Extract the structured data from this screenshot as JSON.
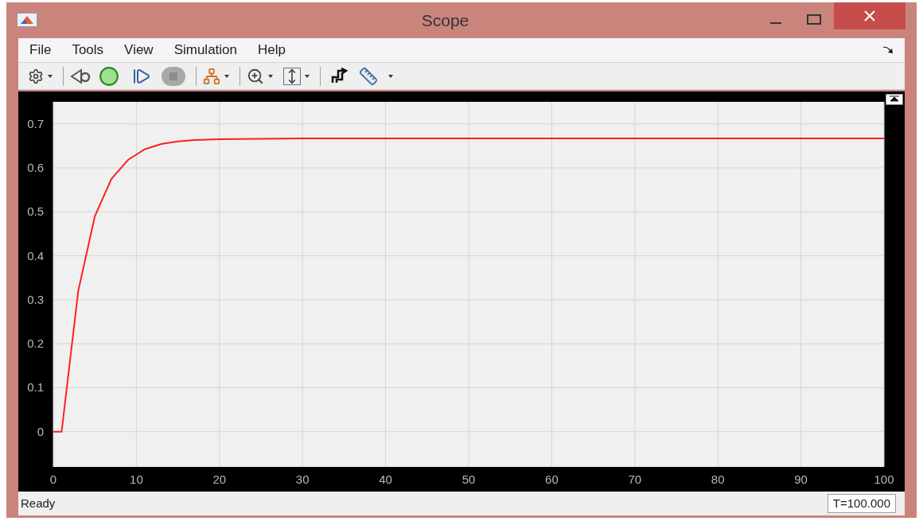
{
  "window": {
    "title": "Scope"
  },
  "menu": [
    "File",
    "Tools",
    "View",
    "Simulation",
    "Help"
  ],
  "plot": {
    "chart_data": {
      "type": "line",
      "grid": true,
      "xlim": [
        0,
        100
      ],
      "ylim": [
        -0.08,
        0.75
      ],
      "xticks": [
        0,
        10,
        20,
        30,
        40,
        50,
        60,
        70,
        80,
        90,
        100
      ],
      "yticks": [
        {
          "value": 0,
          "label": "0"
        },
        0.1,
        0.2,
        0.3,
        0.4,
        0.5,
        0.6,
        0.7
      ],
      "x": [
        0,
        1,
        3,
        5,
        7,
        9,
        11,
        13,
        15,
        17,
        20,
        25,
        30,
        100
      ],
      "series": [
        {
          "color": "#ff2020",
          "values": [
            0,
            0,
            0.32,
            0.49,
            0.575,
            0.618,
            0.642,
            0.654,
            0.66,
            0.663,
            0.665,
            0.666,
            0.667,
            0.667
          ]
        }
      ]
    }
  },
  "status_bar": {
    "text": "Ready",
    "time": "T=100.000"
  }
}
